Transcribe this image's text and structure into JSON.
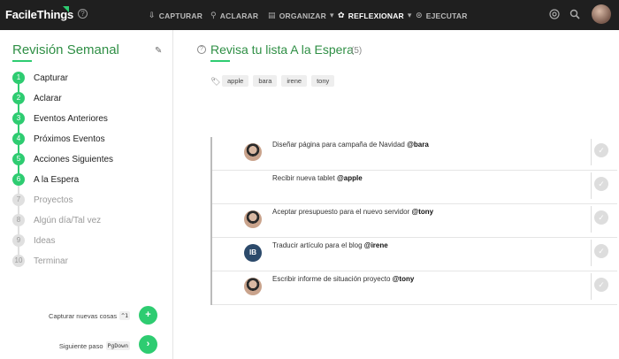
{
  "app": {
    "logo": "FacileThings",
    "help": "?"
  },
  "nav": [
    {
      "label": "CAPTURAR",
      "icon": "inbox-icon"
    },
    {
      "label": "ACLARAR",
      "icon": "process-icon"
    },
    {
      "label": "ORGANIZAR",
      "icon": "folder-icon"
    },
    {
      "label": "REFLEXIONAR",
      "icon": "brain-icon"
    },
    {
      "label": "EJECUTAR",
      "icon": "play-icon"
    }
  ],
  "sidebar": {
    "title": "Revisión Semanal",
    "steps": [
      {
        "num": "1",
        "label": "Capturar",
        "done": true
      },
      {
        "num": "2",
        "label": "Aclarar",
        "done": true
      },
      {
        "num": "3",
        "label": "Eventos Anteriores",
        "done": true
      },
      {
        "num": "4",
        "label": "Próximos Eventos",
        "done": true
      },
      {
        "num": "5",
        "label": "Acciones Siguientes",
        "done": true
      },
      {
        "num": "6",
        "label": "A la Espera",
        "done": true
      },
      {
        "num": "7",
        "label": "Proyectos",
        "done": false
      },
      {
        "num": "8",
        "label": "Algún día/Tal vez",
        "done": false
      },
      {
        "num": "9",
        "label": "Ideas",
        "done": false
      },
      {
        "num": "10",
        "label": "Terminar",
        "done": false
      }
    ],
    "capture": {
      "label": "Capturar nuevas cosas",
      "key": "^1",
      "button": "+"
    },
    "next": {
      "label": "Siguiente paso",
      "key": "PgDown",
      "button": "›"
    }
  },
  "main": {
    "title": "Revisa tu lista A la Espera",
    "count": "(5)",
    "tags": [
      "apple",
      "bara",
      "irene",
      "tony"
    ],
    "items": [
      {
        "text": "Diseñar página para campaña de Navidad",
        "mention": "@bara",
        "avatar": "person"
      },
      {
        "text": "Recibir nueva tablet",
        "mention": "@apple",
        "avatar": "apple"
      },
      {
        "text": "Aceptar presupuesto para el nuevo servidor",
        "mention": "@tony",
        "avatar": "person"
      },
      {
        "text": "Traducir artículo para el blog",
        "mention": "@irene",
        "avatar": "IB"
      },
      {
        "text": "Escribir informe de situación proyecto",
        "mention": "@tony",
        "avatar": "person"
      }
    ]
  },
  "colors": {
    "accent": "#2ecc71",
    "topbar": "#1f1f1f",
    "title_green": "#2f8f45"
  }
}
